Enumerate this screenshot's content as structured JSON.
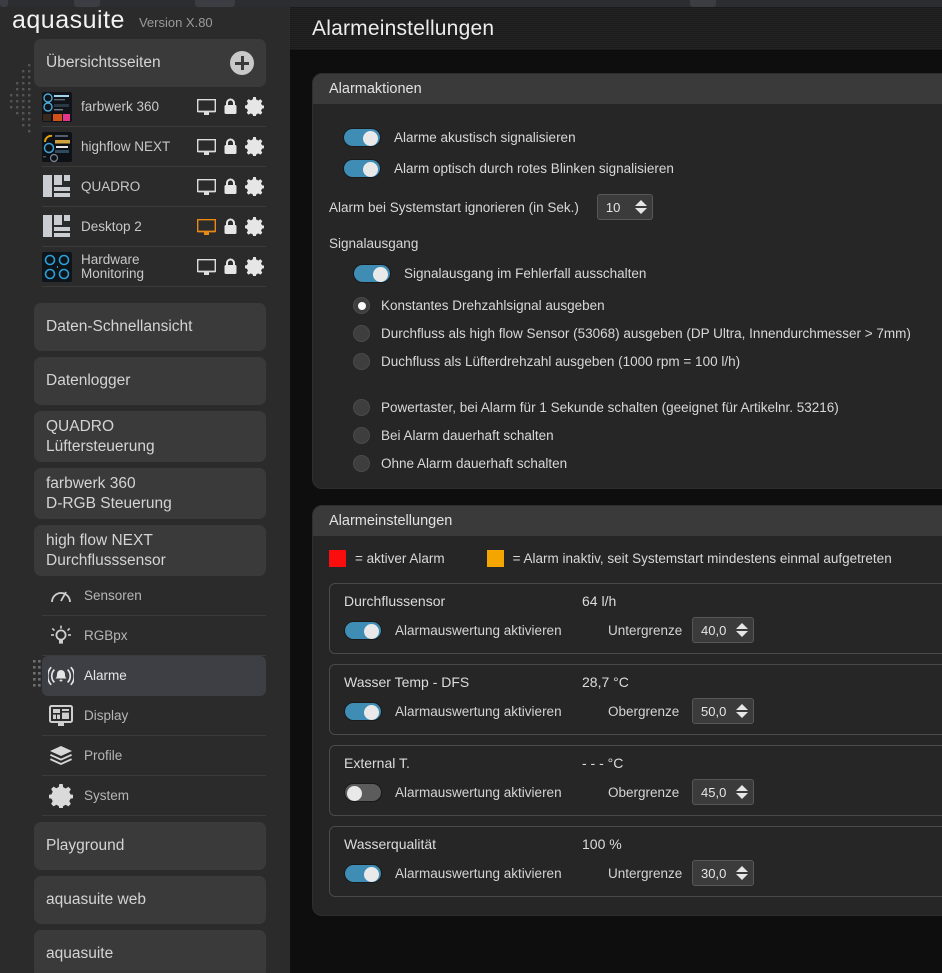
{
  "app": {
    "brand": "aquasuite",
    "version": "Version X.80"
  },
  "sidebar": {
    "overview": {
      "title": "Übersichtsseiten",
      "add_label": "+"
    },
    "pages": [
      {
        "title": "farbwerk 360",
        "thumb": "farbwerk",
        "monitor_active": false
      },
      {
        "title": "highflow NEXT",
        "thumb": "highflow",
        "monitor_active": false
      },
      {
        "title": "QUADRO",
        "thumb": "tiles",
        "monitor_active": false
      },
      {
        "title": "Desktop 2",
        "thumb": "tiles",
        "monitor_active": true
      },
      {
        "title": "Hardware Monitoring",
        "thumb": "hwmon",
        "monitor_active": false
      }
    ],
    "sections": [
      {
        "label": "Daten-Schnellansicht"
      },
      {
        "label": "Datenlogger"
      },
      {
        "label": "QUADRO\nLüftersteuerung"
      },
      {
        "label": "farbwerk 360\nD-RGB Steuerung"
      },
      {
        "label": "high flow NEXT\nDurchflusssensor"
      }
    ],
    "subnav": [
      {
        "label": "Sensoren",
        "icon": "gauge-icon",
        "active": false
      },
      {
        "label": "RGBpx",
        "icon": "bulb-icon",
        "active": false
      },
      {
        "label": "Alarme",
        "icon": "alarm-bell-icon",
        "active": true
      },
      {
        "label": "Display",
        "icon": "display-icon",
        "active": false
      },
      {
        "label": "Profile",
        "icon": "layers-icon",
        "active": false
      },
      {
        "label": "System",
        "icon": "gear-icon",
        "active": false
      }
    ],
    "footer_sections": [
      {
        "label": "Playground"
      },
      {
        "label": "aquasuite web"
      },
      {
        "label": "aquasuite"
      }
    ]
  },
  "content": {
    "title": "Alarmeinstellungen",
    "alarm_actions": {
      "panel_title": "Alarmaktionen",
      "toggles": [
        {
          "label": "Alarme akustisch signalisieren",
          "on": true
        },
        {
          "label": "Alarm optisch durch rotes Blinken signalisieren",
          "on": true
        }
      ],
      "ignore_label": "Alarm bei Systemstart ignorieren (in Sek.)",
      "ignore_value": "10",
      "signal_output": {
        "title": "Signalausgang",
        "toggle": {
          "label": "Signalausgang im Fehlerfall ausschalten",
          "on": true
        },
        "options_group_1": [
          {
            "label": "Konstantes Drehzahlsignal ausgeben",
            "selected": true
          },
          {
            "label": "Durchfluss als high flow Sensor (53068) ausgeben (DP Ultra, Innendurchmesser > 7mm)",
            "selected": false
          },
          {
            "label": "Duchfluss als Lüfterdrehzahl ausgeben (1000 rpm = 100 l/h)",
            "selected": false
          }
        ],
        "options_group_2": [
          {
            "label": "Powertaster, bei Alarm für 1 Sekunde schalten (geeignet für Artikelnr. 53216)",
            "selected": false
          },
          {
            "label": "Bei Alarm dauerhaft schalten",
            "selected": false
          },
          {
            "label": "Ohne Alarm dauerhaft schalten",
            "selected": false
          }
        ]
      }
    },
    "alarm_settings": {
      "panel_title": "Alarmeinstellungen",
      "legend": [
        {
          "color": "#fb0d0d",
          "text": "= aktiver Alarm"
        },
        {
          "color": "#f5a500",
          "text": "= Alarm inaktiv, seit Systemstart mindestens einmal aufgetreten"
        }
      ],
      "enable_label": "Alarmauswertung aktivieren",
      "sensors": [
        {
          "name": "Durchflussensor",
          "value": "64 l/h",
          "enabled": true,
          "limit_label": "Untergrenze",
          "limit_value": "40,0"
        },
        {
          "name": "Wasser Temp - DFS",
          "value": "28,7 °C",
          "enabled": true,
          "limit_label": "Obergrenze",
          "limit_value": "50,0"
        },
        {
          "name": "External T.",
          "value": "- - - °C",
          "enabled": false,
          "limit_label": "Obergrenze",
          "limit_value": "45,0"
        },
        {
          "name": "Wasserqualität",
          "value": "100 %",
          "enabled": true,
          "limit_label": "Untergrenze",
          "limit_value": "30,0"
        }
      ]
    }
  },
  "colors": {
    "accent_blue": "#3f8cb4",
    "monitor_active": "#e88a14",
    "alarm_active": "#fb0d0d",
    "alarm_past": "#f5a500"
  }
}
